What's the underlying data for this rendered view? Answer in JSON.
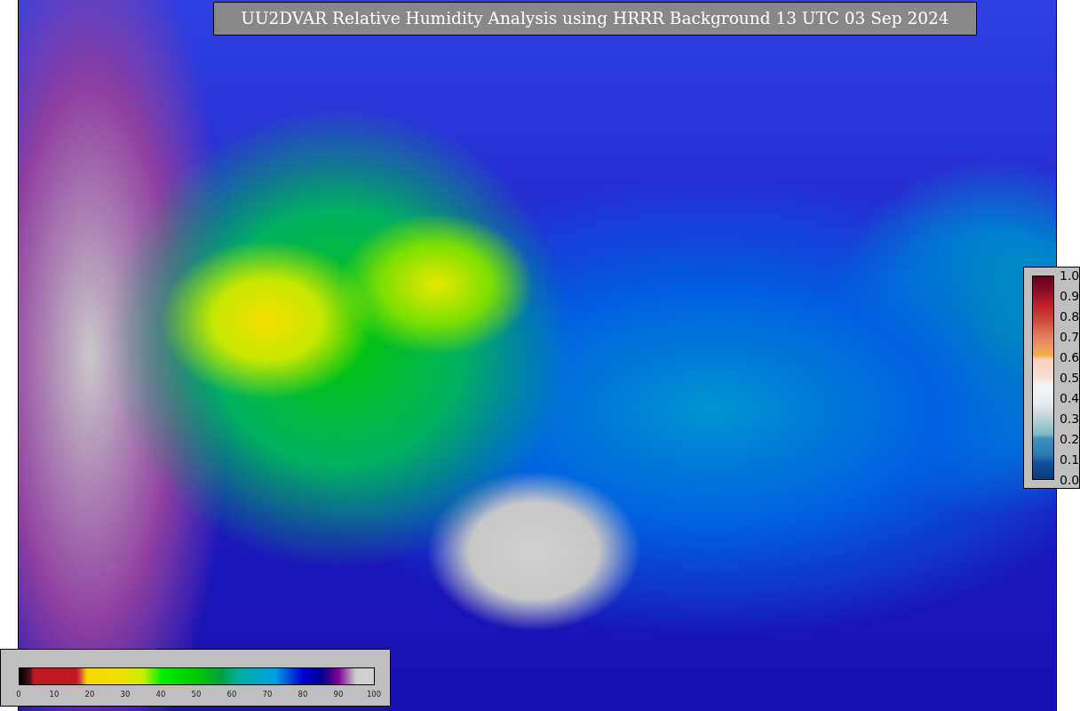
{
  "title": "UU2DVAR Relative Humidity Analysis using HRRR Background 13 UTC 03 Sep 2024",
  "humidity_colorbar": {
    "ticks": [
      "0",
      "10",
      "20",
      "30",
      "40",
      "50",
      "60",
      "70",
      "80",
      "90",
      "100"
    ]
  },
  "fraction_colorbar": {
    "ticks": [
      "1.0",
      "0.9",
      "0.8",
      "0.7",
      "0.6",
      "0.5",
      "0.4",
      "0.3",
      "0.2",
      "0.1",
      "0.0"
    ]
  }
}
